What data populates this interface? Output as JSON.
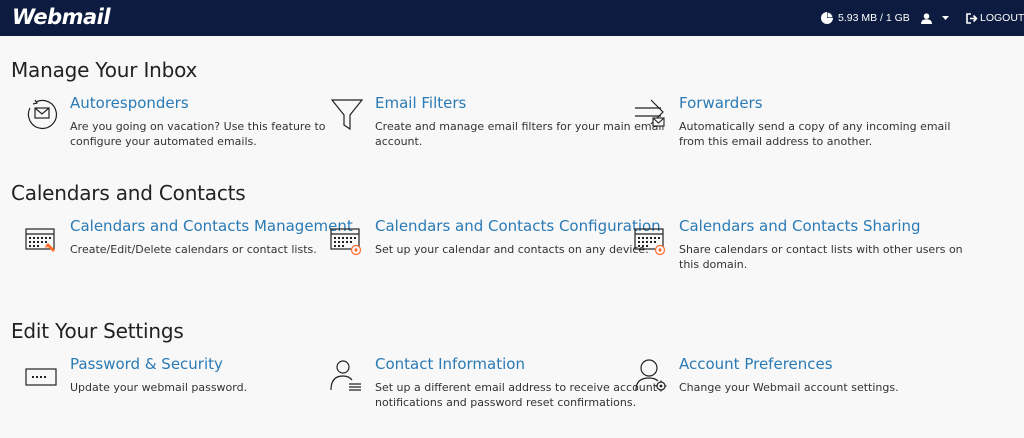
{
  "header": {
    "logo": "Webmail",
    "usage": "5.93 MB / 1 GB",
    "logout": "LOGOUT"
  },
  "sections": [
    {
      "title": "Manage Your Inbox",
      "items": [
        {
          "title": "Autoresponders",
          "desc": "Are you going on vacation? Use this feature to configure your automated emails.",
          "icon": "autoresponder-icon"
        },
        {
          "title": "Email Filters",
          "desc": "Create and manage email filters for your main email account.",
          "icon": "filter-icon"
        },
        {
          "title": "Forwarders",
          "desc": "Automatically send a copy of any incoming email from this email address to another.",
          "icon": "forwarder-icon"
        }
      ]
    },
    {
      "title": "Calendars and Contacts",
      "items": [
        {
          "title": "Calendars and Contacts Management",
          "desc": "Create/Edit/Delete calendars or contact lists.",
          "icon": "calendar-manage-icon"
        },
        {
          "title": "Calendars and Contacts Configuration",
          "desc": "Set up your calendar and contacts on any device.",
          "icon": "calendar-config-icon"
        },
        {
          "title": "Calendars and Contacts Sharing",
          "desc": "Share calendars or contact lists with other users on this domain.",
          "icon": "calendar-share-icon"
        }
      ]
    },
    {
      "title": "Edit Your Settings",
      "items": [
        {
          "title": "Password & Security",
          "desc": "Update your webmail password.",
          "icon": "password-icon"
        },
        {
          "title": "Contact Information",
          "desc": "Set up a different email address to receive account notifications and password reset confirmations.",
          "icon": "contact-info-icon"
        },
        {
          "title": "Account Preferences",
          "desc": "Change your Webmail account settings.",
          "icon": "account-preferences-icon"
        }
      ]
    }
  ]
}
